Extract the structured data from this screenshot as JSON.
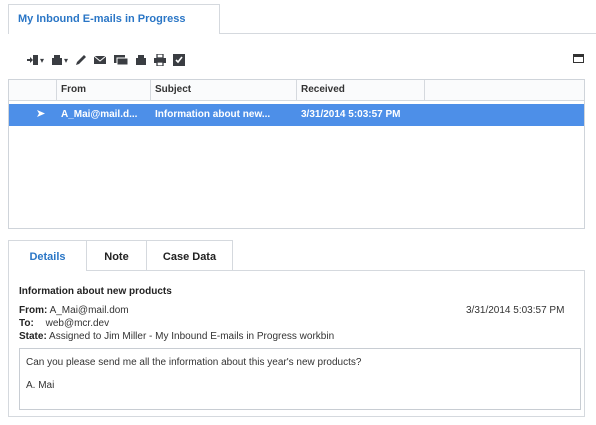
{
  "workbin": {
    "tab_label": "My Inbound E-mails in Progress"
  },
  "toolbar": {
    "icons": [
      "move-to-queue-icon",
      "move-to-workbin-icon",
      "edit-icon",
      "reply-icon",
      "forward-icon",
      "workbin-icon",
      "print-icon",
      "mark-done-icon"
    ]
  },
  "grid": {
    "columns": [
      "",
      "From",
      "Subject",
      "Received",
      ""
    ],
    "rows": [
      {
        "from": "A_Mai@mail.d...",
        "subject": "Information about new...",
        "received": "3/31/2014 5:03:57 PM"
      }
    ]
  },
  "detail_tabs": [
    "Details",
    "Note",
    "Case Data"
  ],
  "details": {
    "subject": "Information about new products",
    "from_label": "From:",
    "from": "A_Mai@mail.dom",
    "to_label": "To:",
    "to": "web@mcr.dev",
    "state_label": "State:",
    "state": "Assigned to Jim Miller - My Inbound E-mails in Progress workbin",
    "date": "3/31/2014 5:03:57 PM",
    "body_line1": "Can you please send me all the information about this year's new products?",
    "body_line2": "A. Mai"
  },
  "colors": {
    "accent": "#2a76c6",
    "selection": "#4d8fe8"
  }
}
